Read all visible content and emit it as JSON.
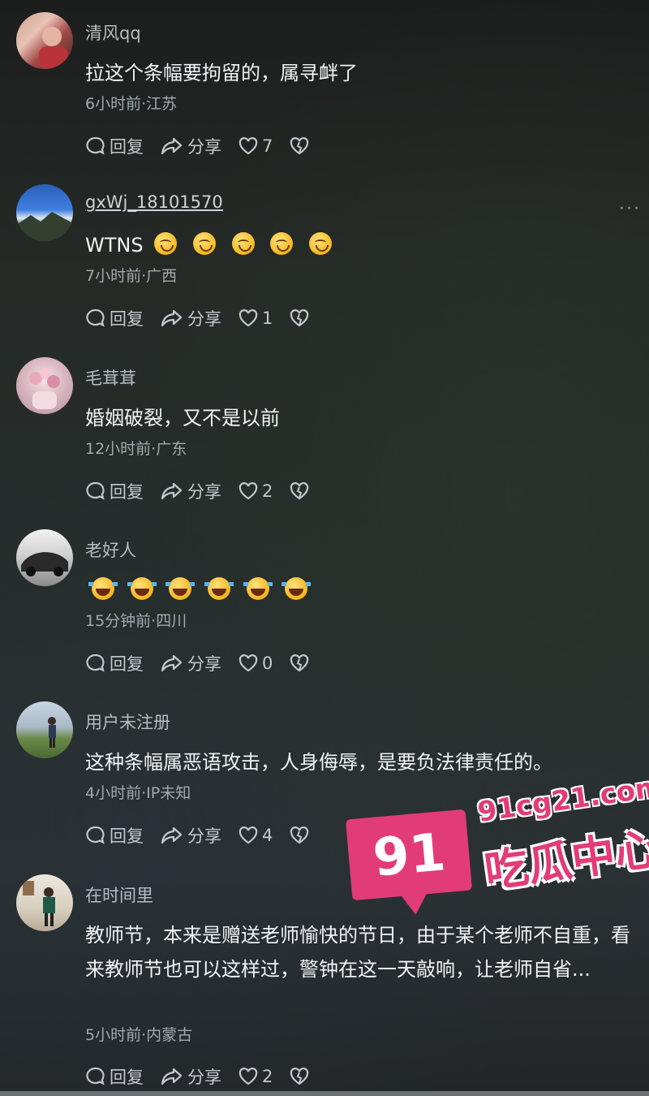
{
  "comments": [
    {
      "username": "清风qq",
      "text": "拉这个条幅要拘留的，属寻衅了",
      "meta": "6小时前·江苏",
      "reply": "回复",
      "share": "分享",
      "likes": "7"
    },
    {
      "username": "gxWj_18101570",
      "text": "WTNS",
      "emoji": "crying-face-emoji",
      "meta": "7小时前·广西",
      "reply": "回复",
      "share": "分享",
      "likes": "1"
    },
    {
      "username": "毛茸茸",
      "text": "婚姻破裂，又不是以前",
      "meta": "12小时前·广东",
      "reply": "回复",
      "share": "分享",
      "likes": "2"
    },
    {
      "username": "老好人",
      "text": "",
      "emoji": "laughing-tears-emoji",
      "meta": "15分钟前·四川",
      "reply": "回复",
      "share": "分享",
      "likes": "0"
    },
    {
      "username": "用户未注册",
      "text": "这种条幅属恶语攻击，人身侮辱，是要负法律责任的。",
      "meta": "4小时前·IP未知",
      "reply": "回复",
      "share": "分享",
      "likes": "4"
    },
    {
      "username": "在时间里",
      "text": "教师节，本来是赠送老师愉快的节日，由于某个老师不自重，看来教师节也可以这样过，警钟在这一天敲响，让老师自省...",
      "meta": "5小时前·内蒙古",
      "reply": "回复",
      "share": "分享",
      "likes": "2"
    }
  ],
  "more_menu": "···",
  "watermark": {
    "number": "91",
    "url": "91cg21.com",
    "name": "吃瓜中心",
    "color": "#e23c77"
  }
}
